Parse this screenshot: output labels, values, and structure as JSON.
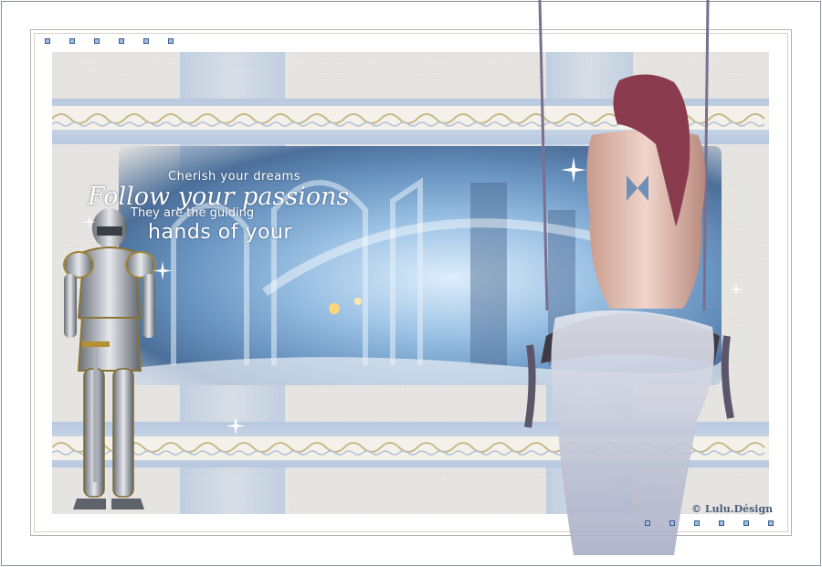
{
  "artwork": {
    "quote": {
      "line1": "Cherish your dreams",
      "line2": "Follow your passions",
      "line3": "They are the guiding",
      "line4": "hands of your"
    },
    "credit": "© Lulu.Désign"
  },
  "colors": {
    "frame_border": "#8a8f96",
    "canvas": "#e9e7e4",
    "band_blue": "#b7c8df",
    "scene_light": "#dfeefa",
    "scene_dark": "#4d6f98",
    "dot_fill": "#9fbce0",
    "dot_border": "#3b5d8f",
    "credit_text": "#4a5d78"
  },
  "icons": [
    "knight-armor",
    "woman-on-swing",
    "butterfly-tattoo",
    "sparkle-star",
    "lace-border",
    "square-dot"
  ]
}
